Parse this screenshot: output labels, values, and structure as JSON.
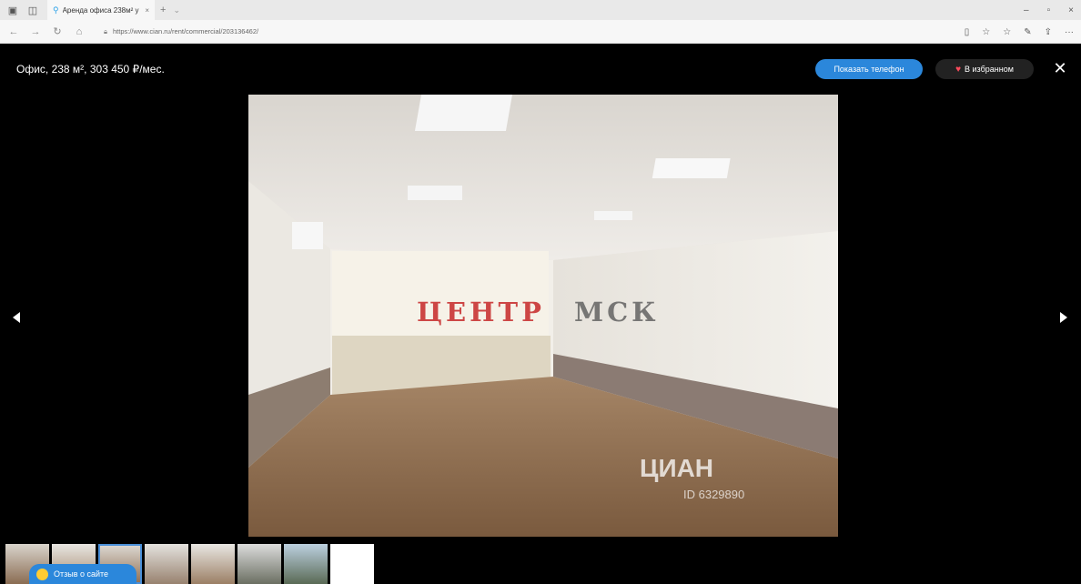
{
  "browser": {
    "tab_title": "Аренда офиса 238м² у",
    "tab_close": "×",
    "new_tab": "+",
    "tab_list": "⌄",
    "url": "https://www.cian.ru/rent/commercial/203136462/",
    "win": {
      "minimize": "–",
      "maximize": "▫",
      "close": "×"
    }
  },
  "viewer": {
    "title": "Офис, 238 м², 303 450 ₽/мес.",
    "phone_button": "Показать телефон",
    "favorite_button": "В избранном",
    "close": "✕"
  },
  "watermarks": {
    "centr": "ЦЕНТР",
    "msk": "МСК",
    "cian": "ЦИАН",
    "listing_id": "ID 6329890"
  },
  "feedback": {
    "label": "Отзыв о сайте"
  },
  "thumbnails": {
    "count": 9,
    "active_index": 2
  },
  "colors": {
    "accent": "#2b87db",
    "heart": "#ff4b5c",
    "watermark_red": "#c62828"
  }
}
